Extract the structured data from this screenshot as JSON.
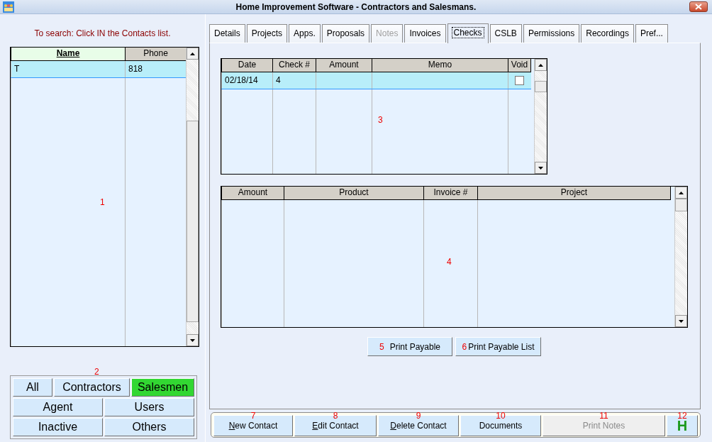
{
  "window": {
    "title": "Home Improvement Software - Contractors and Salesmans."
  },
  "search_hint": "To search: Click IN the Contacts list.",
  "contacts": {
    "callout": "1",
    "columns": [
      {
        "label": "Name",
        "sorted": true
      },
      {
        "label": "Phone",
        "sorted": false
      }
    ],
    "rows": [
      {
        "cells": [
          "T",
          "818"
        ],
        "selected": true
      }
    ]
  },
  "filter": {
    "callout": "2",
    "buttons": [
      {
        "label": "All",
        "selected": false
      },
      {
        "label": "Contractors",
        "selected": false
      },
      {
        "label": "Salesmen",
        "selected": true
      },
      {
        "label": "Agent",
        "selected": false
      },
      {
        "label": "Users",
        "selected": false
      },
      {
        "label": "Inactive",
        "selected": false
      },
      {
        "label": "Others",
        "selected": false
      }
    ]
  },
  "tabs": [
    {
      "label": "Details",
      "selected": false,
      "disabled": false
    },
    {
      "label": "Projects",
      "selected": false,
      "disabled": false
    },
    {
      "label": "Apps.",
      "selected": false,
      "disabled": false
    },
    {
      "label": "Proposals",
      "selected": false,
      "disabled": false
    },
    {
      "label": "Notes",
      "selected": false,
      "disabled": true
    },
    {
      "label": "Invoices",
      "selected": false,
      "disabled": false
    },
    {
      "label": "Checks",
      "selected": true,
      "disabled": false
    },
    {
      "label": "CSLB",
      "selected": false,
      "disabled": false
    },
    {
      "label": "Permissions",
      "selected": false,
      "disabled": false
    },
    {
      "label": "Recordings",
      "selected": false,
      "disabled": false
    },
    {
      "label": "Pref...",
      "selected": false,
      "disabled": false
    }
  ],
  "checks_table": {
    "callout": "3",
    "columns": [
      "Date",
      "Check #",
      "Amount",
      "Memo",
      "Void"
    ],
    "rows": [
      {
        "date": "02/18/14",
        "check_no": "4",
        "void": false,
        "selected": true
      }
    ]
  },
  "payables_table": {
    "callout": "4",
    "columns": [
      "Amount",
      "Product",
      "Invoice #",
      "Project"
    ]
  },
  "print_buttons": [
    {
      "callout": "5",
      "label": "Print Payable"
    },
    {
      "callout": "6",
      "label": "Print Payable List"
    }
  ],
  "bottom_buttons": [
    {
      "callout": "7",
      "label": "New Contact",
      "kind": "text",
      "underline_first": true,
      "disabled": false
    },
    {
      "callout": "8",
      "label": "Edit Contact",
      "kind": "text",
      "underline_first": true,
      "disabled": false
    },
    {
      "callout": "9",
      "label": "Delete Contact",
      "kind": "text",
      "underline_first": true,
      "disabled": false
    },
    {
      "callout": "10",
      "label": "Documents",
      "kind": "text",
      "underline_first": false,
      "disabled": false
    },
    {
      "callout": "11",
      "label": "Print Notes",
      "kind": "text",
      "underline_first": false,
      "disabled": true
    },
    {
      "callout": "12",
      "label": "H",
      "kind": "help",
      "underline_first": false,
      "disabled": false
    }
  ]
}
